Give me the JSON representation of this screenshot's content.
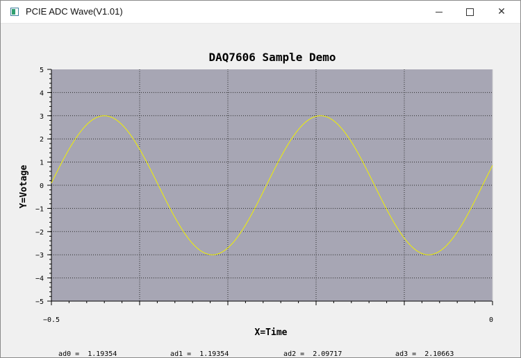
{
  "window": {
    "title": "PCIE ADC Wave(V1.01)",
    "minimize_icon": "minimize-icon",
    "maximize_icon": "maximize-icon",
    "close_icon": "close-icon",
    "close_glyph": "✕"
  },
  "chart_data": {
    "type": "line",
    "title": "DAQ7606 Sample Demo",
    "xlabel": "X=Time",
    "ylabel": "Y=Votage",
    "xlim": [
      -0.5,
      0
    ],
    "ylim": [
      -5,
      5
    ],
    "x_tick_labels": [
      "-0.5",
      "0"
    ],
    "y_tick_labels": [
      "5",
      "4",
      "3",
      "2",
      "1",
      "0",
      "-1",
      "-2",
      "-3",
      "-4",
      "-5"
    ],
    "grid": true,
    "background": "#a7a6b4",
    "line_color": "#f0f000",
    "series": [
      {
        "waveform": "sine",
        "amplitude": 3,
        "period": 0.245,
        "x": [
          -0.5,
          -0.45,
          -0.44,
          -0.4,
          -0.37,
          -0.32,
          -0.28,
          -0.25,
          -0.2,
          -0.15,
          -0.12,
          -0.08,
          -0.04,
          0
        ],
        "values": [
          -0.8,
          2.4,
          3.0,
          1.6,
          -0.5,
          -2.9,
          -1.9,
          0.9,
          3.0,
          0.9,
          -1.6,
          -3.0,
          -1.8,
          -0.6
        ]
      }
    ]
  },
  "readouts": [
    {
      "label": "ad0 =",
      "value": "1.19354"
    },
    {
      "label": "ad1 =",
      "value": "1.19354"
    },
    {
      "label": "ad2 =",
      "value": "2.09717"
    },
    {
      "label": "ad3 =",
      "value": "2.10663"
    }
  ]
}
